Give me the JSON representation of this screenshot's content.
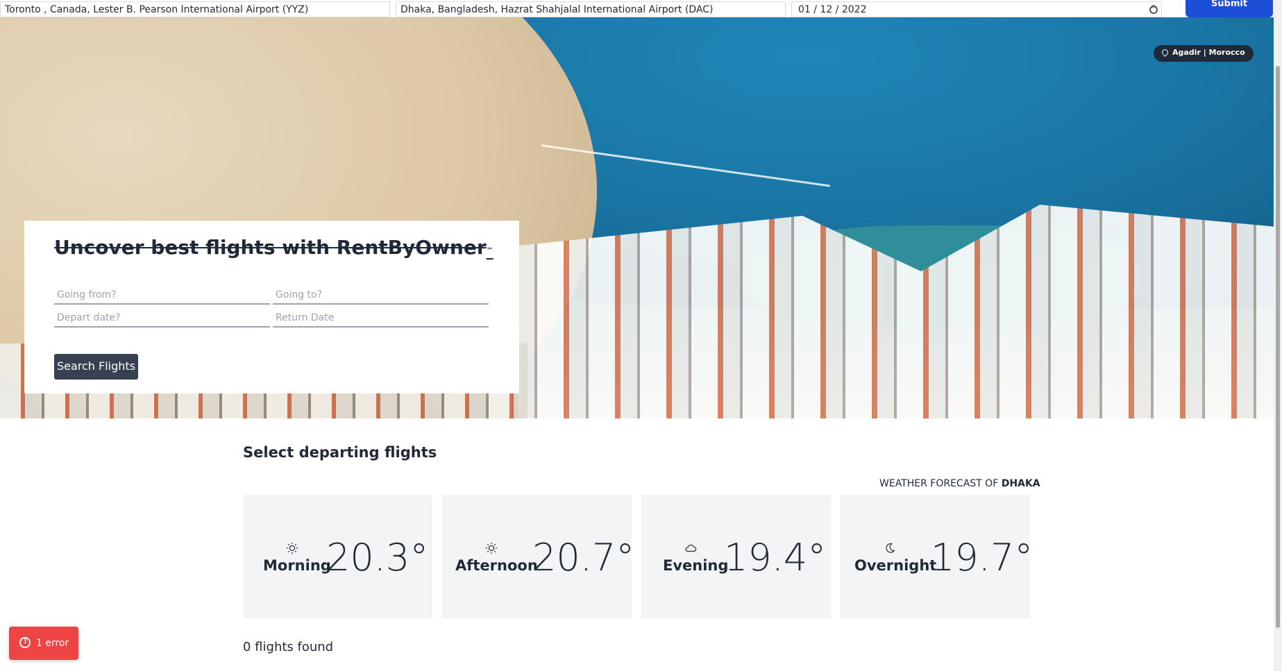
{
  "top_search": {
    "from_value": "Toronto , Canada, Lester B. Pearson International Airport (YYZ)",
    "to_value": "Dhaka, Bangladesh, Hazrat Shahjalal International Airport (DAC)",
    "date_value": "01 / 12 / 2022",
    "submit_label": "Submit",
    "clear_icon": "clear-circle-icon"
  },
  "hero": {
    "location_badge": "Agadir | Morocco",
    "location_icon": "map-pin-icon"
  },
  "search_card": {
    "title": "Uncover best flights with RentByOwner",
    "title_mark": "™",
    "going_from_placeholder": "Going from?",
    "going_to_placeholder": "Going to?",
    "depart_placeholder": "Depart date?",
    "return_placeholder": "Return Date",
    "search_button": "Search Flights"
  },
  "results": {
    "section_title": "Select departing flights",
    "weather_prefix": "Weather forecast of",
    "weather_city": "Dhaka",
    "forecast": [
      {
        "label": "Morning",
        "temp": "20.3°",
        "icon": "sun-icon"
      },
      {
        "label": "Afternoon",
        "temp": "20.7°",
        "icon": "sun-icon"
      },
      {
        "label": "Evening",
        "temp": "19.4°",
        "icon": "cloud-icon"
      },
      {
        "label": "Overnight",
        "temp": "19.7°",
        "icon": "moon-icon"
      }
    ],
    "flights_found": "0 flights found"
  },
  "error_toast": {
    "label": "1 error",
    "icon": "alert-circle-icon"
  },
  "colors": {
    "submit_blue": "#1d4ed8",
    "button_dark": "#374151",
    "error_red": "#ef4444",
    "card_gray": "#f3f4f6"
  }
}
